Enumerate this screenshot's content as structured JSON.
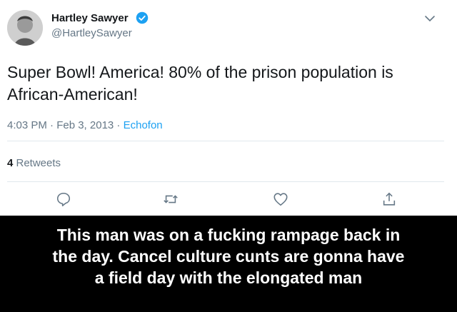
{
  "tweet": {
    "display_name": "Hartley Sawyer",
    "handle": "@HartleySawyer",
    "text_line1": "Super Bowl! America! 80% of the prison population is",
    "text_line2": "African-American!",
    "time": "4:03 PM · Feb 3, 2013 · ",
    "source": "Echofon",
    "retweet_count": "4",
    "retweet_label": " Retweets",
    "icons": [
      "reply-icon",
      "retweet-icon",
      "like-icon",
      "share-icon"
    ]
  },
  "caption": {
    "line1": "This man was on a fucking rampage back in",
    "line2": "the day. Cancel culture cunts are gonna have",
    "line3": "a field day with the elongated man"
  },
  "colors": {
    "link": "#1da1f2",
    "secondary": "#657786",
    "primary": "#14171a"
  }
}
